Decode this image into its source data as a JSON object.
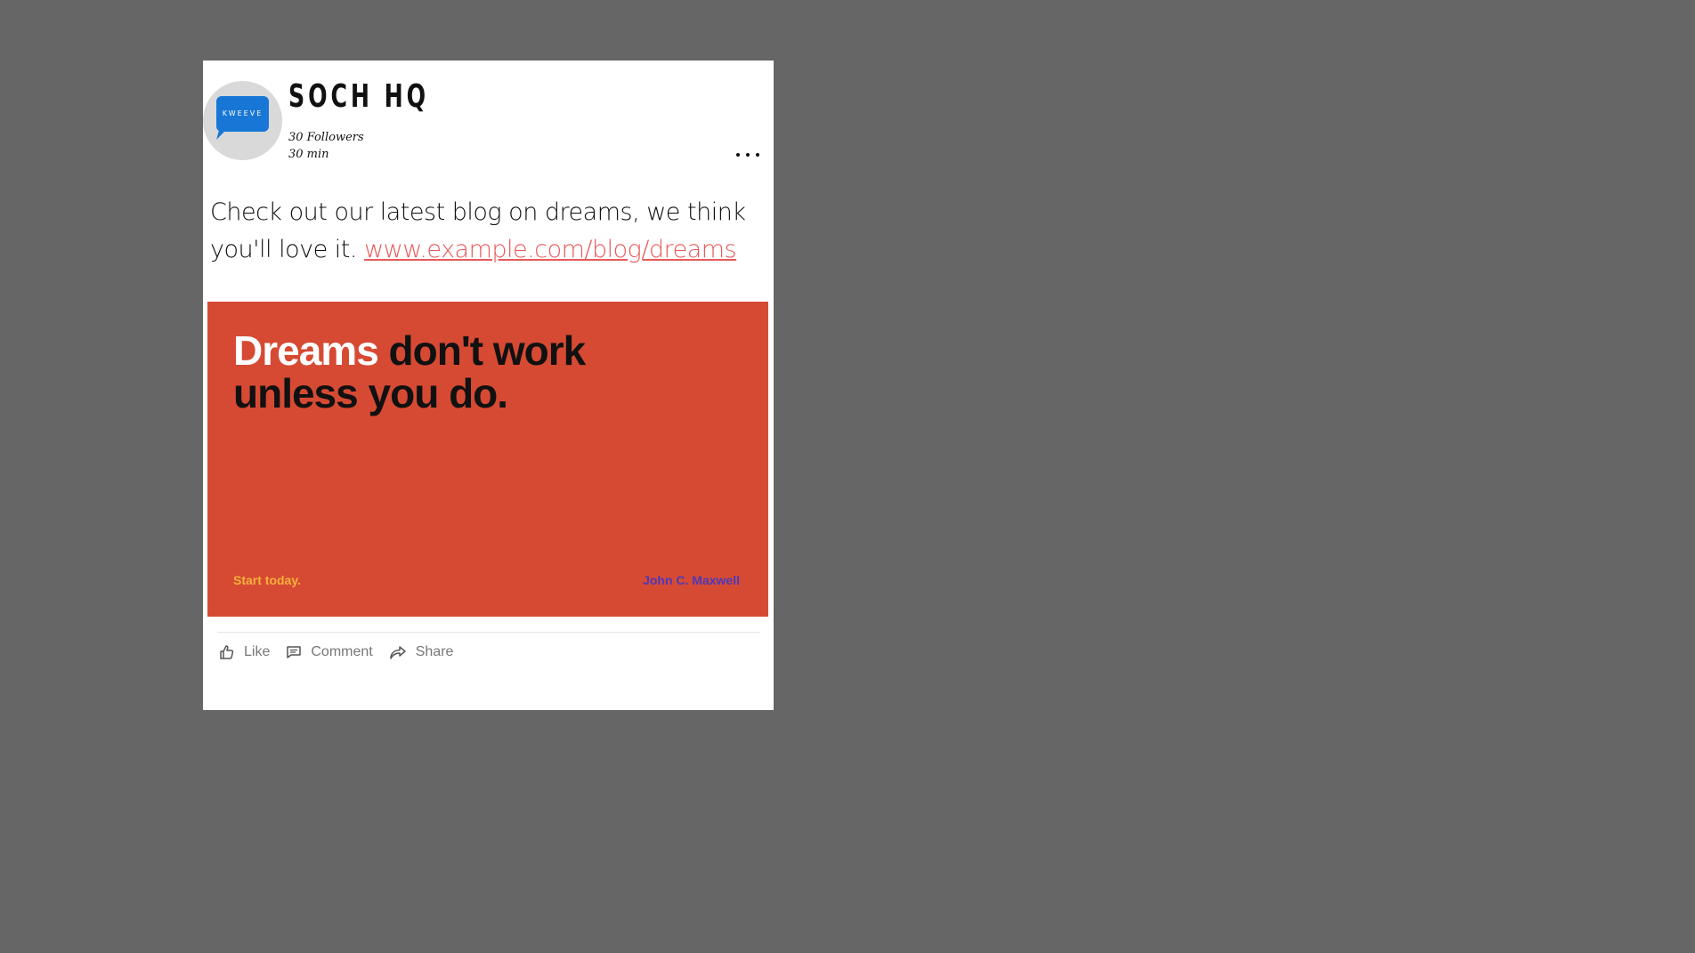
{
  "post": {
    "author_name": "SOCH HQ",
    "avatar_text": "KWEEVE",
    "followers": "30 Followers",
    "time": "30 min",
    "text": "Check out our latest blog on dreams, we think you'll love it. ",
    "link": "www.example.com/blog/dreams",
    "more_icon": "more-dots-icon"
  },
  "image": {
    "quote_highlight": "Dreams",
    "quote_rest_line1": " don't work",
    "quote_line2": "unless you do.",
    "tagline": "Start today.",
    "author": "John C. Maxwell",
    "colors": {
      "background": "#d64a33",
      "highlight": "#ffffff",
      "tagline": "#f5b13b",
      "author": "#4d39b8"
    }
  },
  "actions": [
    {
      "label": "Like",
      "icon": "thumbs-up-icon"
    },
    {
      "label": "Comment",
      "icon": "comment-icon"
    },
    {
      "label": "Share",
      "icon": "share-icon"
    }
  ],
  "colors": {
    "page_background": "#666666",
    "link": "#e8595a",
    "avatar_bubble": "#1877d6"
  }
}
